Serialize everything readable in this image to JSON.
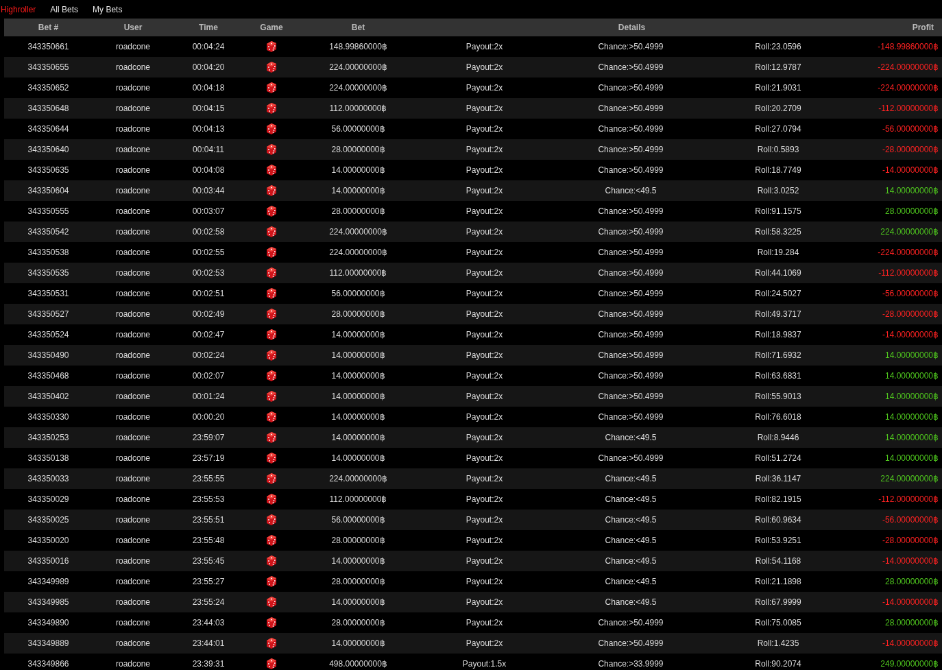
{
  "tabs": [
    {
      "label": "Highroller",
      "selected": true
    },
    {
      "label": "All Bets",
      "selected": false
    },
    {
      "label": "My Bets",
      "selected": false
    }
  ],
  "table": {
    "columns": [
      "Bet #",
      "User",
      "Time",
      "Game",
      "Bet",
      "Details",
      "Profit"
    ],
    "rows": [
      {
        "bet_id": "343350661",
        "user": "roadcone",
        "time": "00:04:24",
        "bet": "148.99860000฿",
        "payout": "Payout:2x",
        "chance": "Chance:>50.4999",
        "roll": "Roll:23.0596",
        "profit": "-148.99860000฿",
        "won": false
      },
      {
        "bet_id": "343350655",
        "user": "roadcone",
        "time": "00:04:20",
        "bet": "224.00000000฿",
        "payout": "Payout:2x",
        "chance": "Chance:>50.4999",
        "roll": "Roll:12.9787",
        "profit": "-224.00000000฿",
        "won": false
      },
      {
        "bet_id": "343350652",
        "user": "roadcone",
        "time": "00:04:18",
        "bet": "224.00000000฿",
        "payout": "Payout:2x",
        "chance": "Chance:>50.4999",
        "roll": "Roll:21.9031",
        "profit": "-224.00000000฿",
        "won": false
      },
      {
        "bet_id": "343350648",
        "user": "roadcone",
        "time": "00:04:15",
        "bet": "112.00000000฿",
        "payout": "Payout:2x",
        "chance": "Chance:>50.4999",
        "roll": "Roll:20.2709",
        "profit": "-112.00000000฿",
        "won": false
      },
      {
        "bet_id": "343350644",
        "user": "roadcone",
        "time": "00:04:13",
        "bet": "56.00000000฿",
        "payout": "Payout:2x",
        "chance": "Chance:>50.4999",
        "roll": "Roll:27.0794",
        "profit": "-56.00000000฿",
        "won": false
      },
      {
        "bet_id": "343350640",
        "user": "roadcone",
        "time": "00:04:11",
        "bet": "28.00000000฿",
        "payout": "Payout:2x",
        "chance": "Chance:>50.4999",
        "roll": "Roll:0.5893",
        "profit": "-28.00000000฿",
        "won": false
      },
      {
        "bet_id": "343350635",
        "user": "roadcone",
        "time": "00:04:08",
        "bet": "14.00000000฿",
        "payout": "Payout:2x",
        "chance": "Chance:>50.4999",
        "roll": "Roll:18.7749",
        "profit": "-14.00000000฿",
        "won": false
      },
      {
        "bet_id": "343350604",
        "user": "roadcone",
        "time": "00:03:44",
        "bet": "14.00000000฿",
        "payout": "Payout:2x",
        "chance": "Chance:<49.5",
        "roll": "Roll:3.0252",
        "profit": "14.00000000฿",
        "won": true
      },
      {
        "bet_id": "343350555",
        "user": "roadcone",
        "time": "00:03:07",
        "bet": "28.00000000฿",
        "payout": "Payout:2x",
        "chance": "Chance:>50.4999",
        "roll": "Roll:91.1575",
        "profit": "28.00000000฿",
        "won": true
      },
      {
        "bet_id": "343350542",
        "user": "roadcone",
        "time": "00:02:58",
        "bet": "224.00000000฿",
        "payout": "Payout:2x",
        "chance": "Chance:>50.4999",
        "roll": "Roll:58.3225",
        "profit": "224.00000000฿",
        "won": true
      },
      {
        "bet_id": "343350538",
        "user": "roadcone",
        "time": "00:02:55",
        "bet": "224.00000000฿",
        "payout": "Payout:2x",
        "chance": "Chance:>50.4999",
        "roll": "Roll:19.284",
        "profit": "-224.00000000฿",
        "won": false
      },
      {
        "bet_id": "343350535",
        "user": "roadcone",
        "time": "00:02:53",
        "bet": "112.00000000฿",
        "payout": "Payout:2x",
        "chance": "Chance:>50.4999",
        "roll": "Roll:44.1069",
        "profit": "-112.00000000฿",
        "won": false
      },
      {
        "bet_id": "343350531",
        "user": "roadcone",
        "time": "00:02:51",
        "bet": "56.00000000฿",
        "payout": "Payout:2x",
        "chance": "Chance:>50.4999",
        "roll": "Roll:24.5027",
        "profit": "-56.00000000฿",
        "won": false
      },
      {
        "bet_id": "343350527",
        "user": "roadcone",
        "time": "00:02:49",
        "bet": "28.00000000฿",
        "payout": "Payout:2x",
        "chance": "Chance:>50.4999",
        "roll": "Roll:49.3717",
        "profit": "-28.00000000฿",
        "won": false
      },
      {
        "bet_id": "343350524",
        "user": "roadcone",
        "time": "00:02:47",
        "bet": "14.00000000฿",
        "payout": "Payout:2x",
        "chance": "Chance:>50.4999",
        "roll": "Roll:18.9837",
        "profit": "-14.00000000฿",
        "won": false
      },
      {
        "bet_id": "343350490",
        "user": "roadcone",
        "time": "00:02:24",
        "bet": "14.00000000฿",
        "payout": "Payout:2x",
        "chance": "Chance:>50.4999",
        "roll": "Roll:71.6932",
        "profit": "14.00000000฿",
        "won": true
      },
      {
        "bet_id": "343350468",
        "user": "roadcone",
        "time": "00:02:07",
        "bet": "14.00000000฿",
        "payout": "Payout:2x",
        "chance": "Chance:>50.4999",
        "roll": "Roll:63.6831",
        "profit": "14.00000000฿",
        "won": true
      },
      {
        "bet_id": "343350402",
        "user": "roadcone",
        "time": "00:01:24",
        "bet": "14.00000000฿",
        "payout": "Payout:2x",
        "chance": "Chance:>50.4999",
        "roll": "Roll:55.9013",
        "profit": "14.00000000฿",
        "won": true
      },
      {
        "bet_id": "343350330",
        "user": "roadcone",
        "time": "00:00:20",
        "bet": "14.00000000฿",
        "payout": "Payout:2x",
        "chance": "Chance:>50.4999",
        "roll": "Roll:76.6018",
        "profit": "14.00000000฿",
        "won": true
      },
      {
        "bet_id": "343350253",
        "user": "roadcone",
        "time": "23:59:07",
        "bet": "14.00000000฿",
        "payout": "Payout:2x",
        "chance": "Chance:<49.5",
        "roll": "Roll:8.9446",
        "profit": "14.00000000฿",
        "won": true
      },
      {
        "bet_id": "343350138",
        "user": "roadcone",
        "time": "23:57:19",
        "bet": "14.00000000฿",
        "payout": "Payout:2x",
        "chance": "Chance:>50.4999",
        "roll": "Roll:51.2724",
        "profit": "14.00000000฿",
        "won": true
      },
      {
        "bet_id": "343350033",
        "user": "roadcone",
        "time": "23:55:55",
        "bet": "224.00000000฿",
        "payout": "Payout:2x",
        "chance": "Chance:<49.5",
        "roll": "Roll:36.1147",
        "profit": "224.00000000฿",
        "won": true
      },
      {
        "bet_id": "343350029",
        "user": "roadcone",
        "time": "23:55:53",
        "bet": "112.00000000฿",
        "payout": "Payout:2x",
        "chance": "Chance:<49.5",
        "roll": "Roll:82.1915",
        "profit": "-112.00000000฿",
        "won": false
      },
      {
        "bet_id": "343350025",
        "user": "roadcone",
        "time": "23:55:51",
        "bet": "56.00000000฿",
        "payout": "Payout:2x",
        "chance": "Chance:<49.5",
        "roll": "Roll:60.9634",
        "profit": "-56.00000000฿",
        "won": false
      },
      {
        "bet_id": "343350020",
        "user": "roadcone",
        "time": "23:55:48",
        "bet": "28.00000000฿",
        "payout": "Payout:2x",
        "chance": "Chance:<49.5",
        "roll": "Roll:53.9251",
        "profit": "-28.00000000฿",
        "won": false
      },
      {
        "bet_id": "343350016",
        "user": "roadcone",
        "time": "23:55:45",
        "bet": "14.00000000฿",
        "payout": "Payout:2x",
        "chance": "Chance:<49.5",
        "roll": "Roll:54.1168",
        "profit": "-14.00000000฿",
        "won": false
      },
      {
        "bet_id": "343349989",
        "user": "roadcone",
        "time": "23:55:27",
        "bet": "28.00000000฿",
        "payout": "Payout:2x",
        "chance": "Chance:<49.5",
        "roll": "Roll:21.1898",
        "profit": "28.00000000฿",
        "won": true
      },
      {
        "bet_id": "343349985",
        "user": "roadcone",
        "time": "23:55:24",
        "bet": "14.00000000฿",
        "payout": "Payout:2x",
        "chance": "Chance:<49.5",
        "roll": "Roll:67.9999",
        "profit": "-14.00000000฿",
        "won": false
      },
      {
        "bet_id": "343349890",
        "user": "roadcone",
        "time": "23:44:03",
        "bet": "28.00000000฿",
        "payout": "Payout:2x",
        "chance": "Chance:>50.4999",
        "roll": "Roll:75.0085",
        "profit": "28.00000000฿",
        "won": true
      },
      {
        "bet_id": "343349889",
        "user": "roadcone",
        "time": "23:44:01",
        "bet": "14.00000000฿",
        "payout": "Payout:2x",
        "chance": "Chance:>50.4999",
        "roll": "Roll:1.4235",
        "profit": "-14.00000000฿",
        "won": false
      },
      {
        "bet_id": "343349866",
        "user": "roadcone",
        "time": "23:39:31",
        "bet": "498.00000000฿",
        "payout": "Payout:1.5x",
        "chance": "Chance:>33.9999",
        "roll": "Roll:90.2074",
        "profit": "249.00000000฿",
        "won": true
      }
    ]
  }
}
